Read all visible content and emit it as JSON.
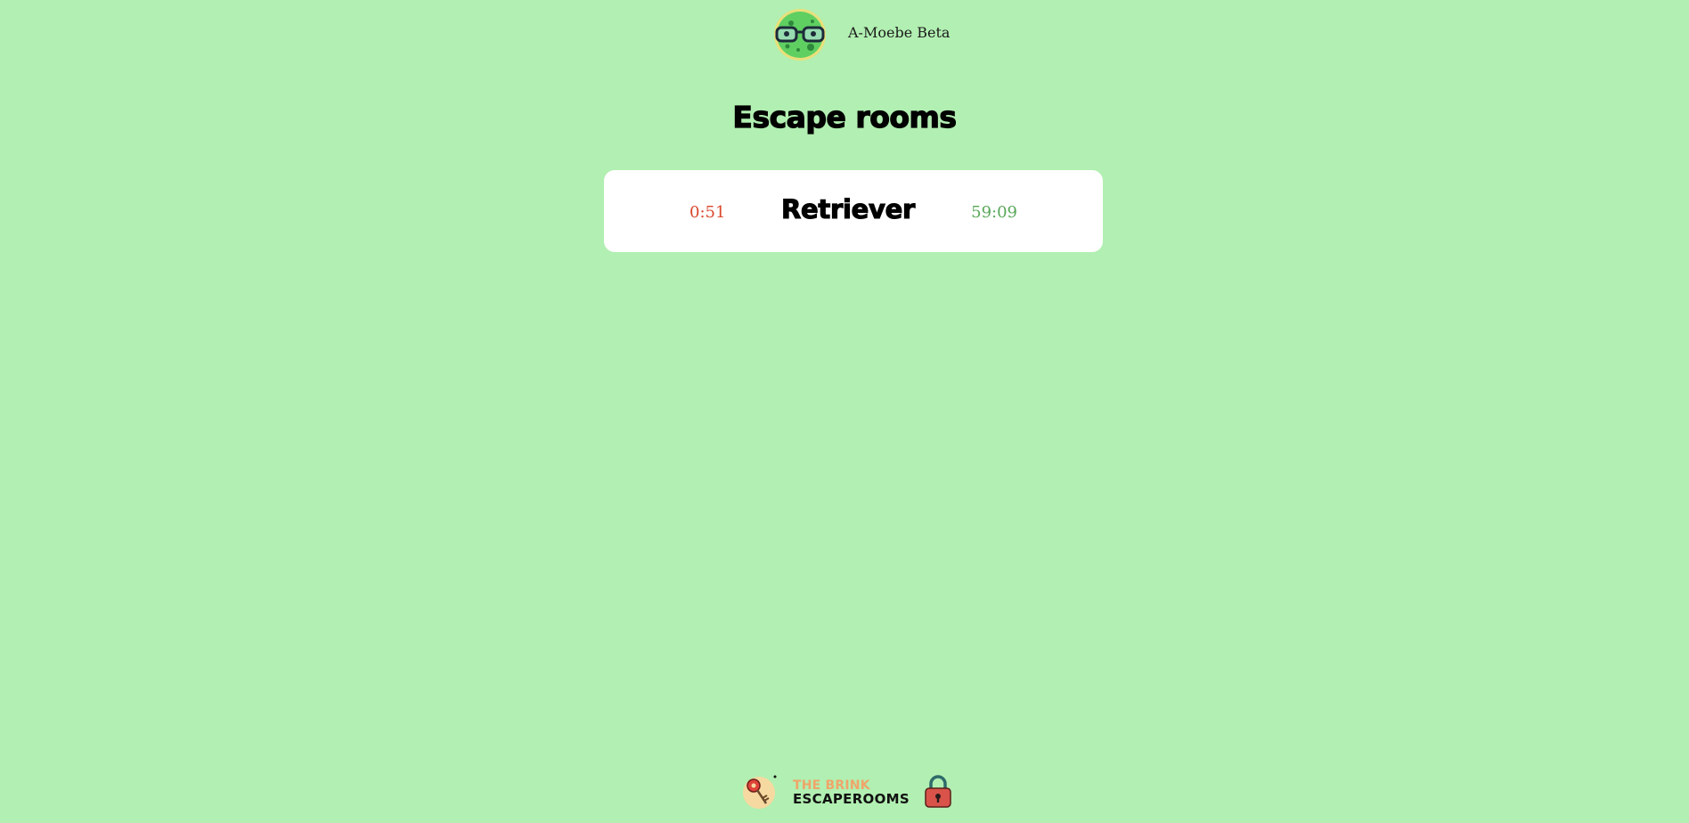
{
  "header": {
    "app_name": "A-Moebe Beta",
    "avatar_icon": "amoeba-with-glasses-icon"
  },
  "page": {
    "title": "Escape rooms"
  },
  "rooms": [
    {
      "name": "Retriever",
      "time_used": "0:51",
      "time_left": "59:09"
    }
  ],
  "footer": {
    "brand_line1": "THE BRINK",
    "brand_line2": "ESCAPEROOMS",
    "key_icon": "key-icon",
    "lock_icon": "padlock-icon"
  },
  "colors": {
    "background": "#b2efb2",
    "card": "#ffffff",
    "time_used": "#d9472b",
    "time_left": "#5aa85a",
    "brand_accent": "#f0a56a"
  }
}
